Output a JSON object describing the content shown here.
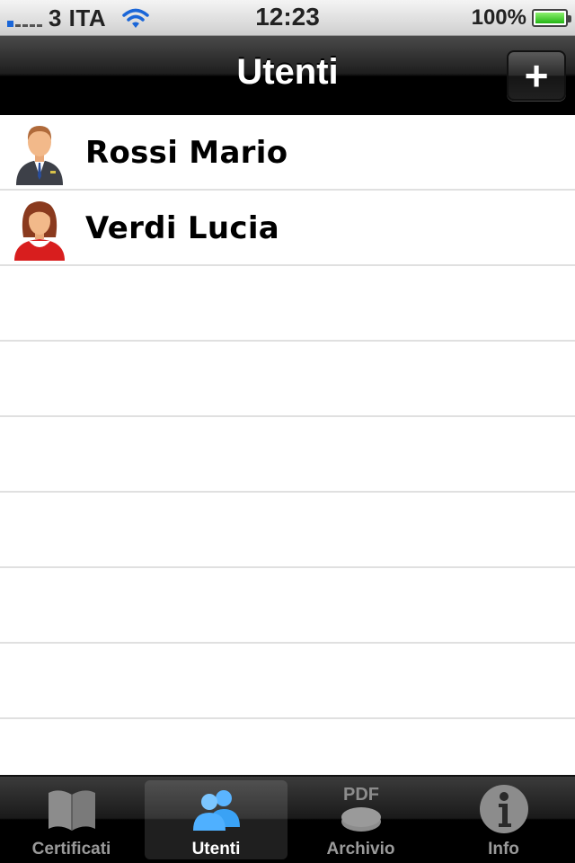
{
  "status_bar": {
    "carrier": "3 ITA",
    "time": "12:23",
    "battery": "100%"
  },
  "nav": {
    "title": "Utenti",
    "add_label": "+"
  },
  "users": [
    {
      "name": "Rossi Mario",
      "avatar": "man-avatar-icon"
    },
    {
      "name": "Verdi Lucia",
      "avatar": "woman-avatar-icon"
    }
  ],
  "tabs": [
    {
      "label": "Certificati",
      "icon": "book-icon",
      "active": false
    },
    {
      "label": "Utenti",
      "icon": "users-icon",
      "active": true
    },
    {
      "label": "Archivio",
      "icon": "pdf-archive-icon",
      "active": false,
      "icon_text": "PDF"
    },
    {
      "label": "Info",
      "icon": "info-icon",
      "active": false
    }
  ],
  "colors": {
    "tab_active": "#3aa2f5",
    "tab_inactive": "#9a9a9a",
    "separator": "#e0e0e0"
  }
}
